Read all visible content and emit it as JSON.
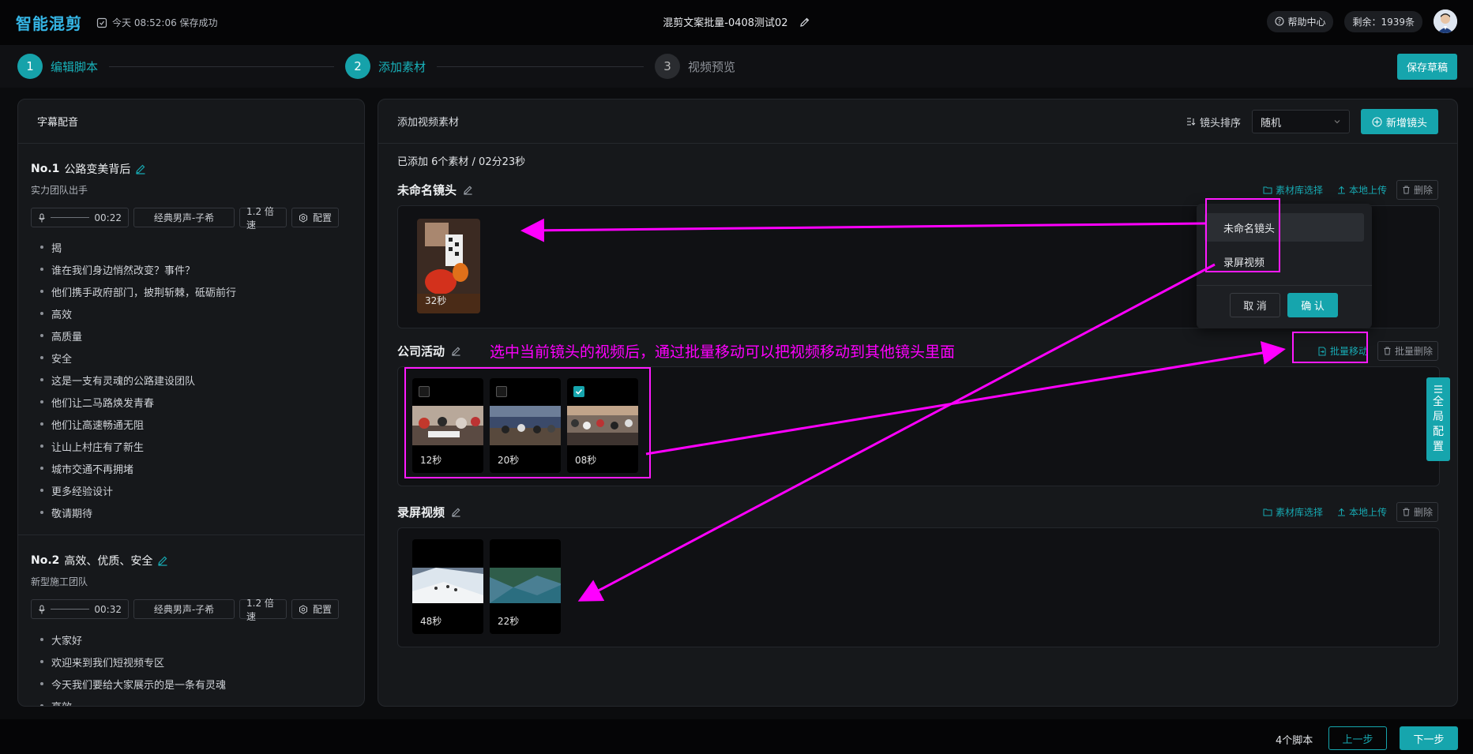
{
  "app": {
    "logo": "智能混剪",
    "save_status": "今天 08:52:06 保存成功",
    "doc_title": "混剪文案批量-0408测试02",
    "help": "帮助中心",
    "remaining": "剩余：1939条"
  },
  "steps": [
    {
      "num": "1",
      "label": "编辑脚本",
      "state": "active"
    },
    {
      "num": "2",
      "label": "添加素材",
      "state": "active"
    },
    {
      "num": "3",
      "label": "视频预览",
      "state": "inactive"
    }
  ],
  "save_draft": "保存草稿",
  "left": {
    "title": "字幕配音",
    "scripts": [
      {
        "no": "No.1",
        "title": "公路变美背后",
        "subtitle": "实力团队出手",
        "duration": "00:22",
        "voice": "经典男声-子希",
        "speed": "1.2 倍速",
        "config": "配置",
        "lines": [
          "揭",
          "谁在我们身边悄然改变？事件？",
          "他们携手政府部门，披荆斩棘，砥砺前行",
          "高效",
          "高质量",
          "安全",
          "这是一支有灵魂的公路建设团队",
          "他们让二马路焕发青春",
          "他们让高速畅通无阻",
          "让山上村庄有了新生",
          "城市交通不再拥堵",
          "更多经验设计",
          "敬请期待"
        ]
      },
      {
        "no": "No.2",
        "title": "高效、优质、安全",
        "subtitle": "新型施工团队",
        "duration": "00:32",
        "voice": "经典男声-子希",
        "speed": "1.2 倍速",
        "config": "配置",
        "lines": [
          "大家好",
          "欢迎来到我们短视频专区",
          "今天我们要给大家展示的是一条有灵魂",
          "高效"
        ]
      }
    ]
  },
  "right": {
    "title": "添加视频素材",
    "sort_label": "镜头排序",
    "sort_value": "随机",
    "add_shot": "新增镜头",
    "added_summary": "已添加 6个素材 / 02分23秒",
    "library": "素材库选择",
    "upload": "本地上传",
    "delete": "删除",
    "batch_move": "批量移动",
    "batch_delete": "批量删除",
    "shots": [
      {
        "title": "未命名镜头",
        "clips": [
          "32秒"
        ]
      },
      {
        "title": "公司活动",
        "clips": [
          "12秒",
          "20秒",
          "08秒"
        ],
        "checked": [
          false,
          false,
          true
        ]
      },
      {
        "title": "录屏视频",
        "clips": [
          "48秒",
          "22秒"
        ]
      }
    ]
  },
  "popup": {
    "options": [
      "未命名镜头",
      "录屏视频"
    ],
    "cancel": "取 消",
    "confirm": "确 认"
  },
  "side_tab": [
    "全",
    "局",
    "配",
    "置"
  ],
  "bottom": {
    "count": "4个脚本",
    "prev": "上一步",
    "next": "下一步"
  },
  "annotation": "选中当前镜头的视频后，通过批量移动可以把视频移动到其他镜头里面",
  "colors": {
    "accent": "#16a5ad",
    "annotation": "#ff00ff",
    "background": "#0b0c0e"
  }
}
